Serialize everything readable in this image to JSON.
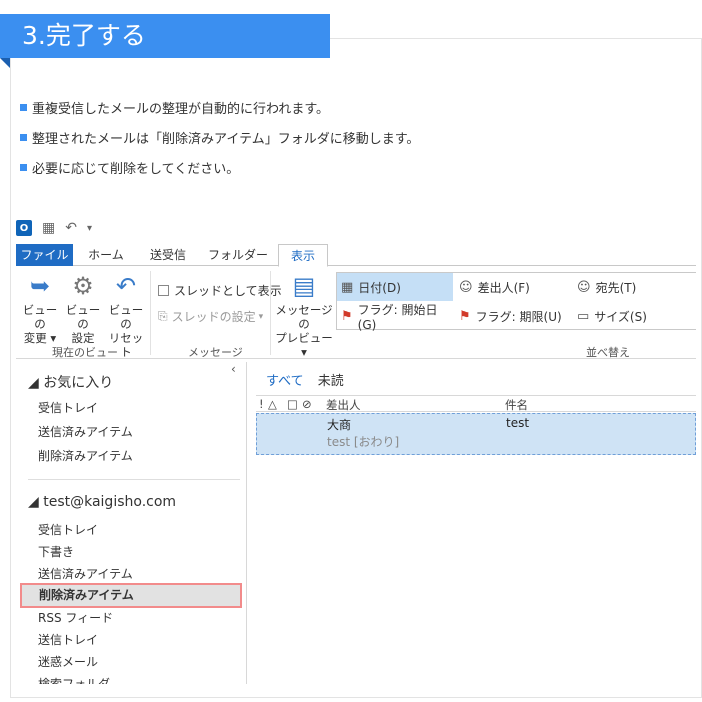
{
  "step": {
    "title": "3.完了する"
  },
  "bullets": [
    "重複受信したメールの整理が自動的に行われます。",
    "整理されたメールは「削除済みアイテム」フォルダに移動します。",
    "必要に応じて削除をしてください。"
  ],
  "qat": {
    "logo": "O",
    "icons": [
      "outlook-logo-icon",
      "send-receive-icon",
      "undo-icon",
      "customize-icon"
    ]
  },
  "tabs": [
    "ファイル",
    "ホーム",
    "送受信",
    "フォルダー",
    "表示"
  ],
  "active_tab": "表示",
  "ribbon": {
    "view_change": [
      "ビューの",
      "変更"
    ],
    "view_settings": [
      "ビューの",
      "設定"
    ],
    "view_reset": [
      "ビューの",
      "リセット"
    ],
    "group_current_view": "現在のビュー",
    "thread_view": "スレッドとして表示",
    "thread_settings": "スレッドの設定",
    "group_messages": "メッセージ",
    "message_preview": [
      "メッセージの",
      "プレビュー"
    ],
    "sort": {
      "date": "日付(D)",
      "from": "差出人(F)",
      "to": "宛先(T)",
      "flag_start": "フラグ: 開始日(G)",
      "flag_due": "フラグ: 期限(U)",
      "size": "サイズ(S)"
    },
    "group_arrange": "並べ替え"
  },
  "folder_pane": {
    "favorites_header": "お気に入り",
    "favorites": [
      "受信トレイ",
      "送信済みアイテム",
      "削除済みアイテム"
    ],
    "account_header": "test@kaigisho.com",
    "account_folders": [
      "受信トレイ",
      "下書き",
      "送信済みアイテム",
      "削除済みアイテム",
      "RSS フィード",
      "送信トレイ",
      "迷惑メール",
      "検索フォルダ"
    ],
    "selected_folder": "削除済みアイテム"
  },
  "mail_list": {
    "filter_all": "すべて",
    "filter_unread": "未読",
    "columns": {
      "importance": "!",
      "reminder": "△",
      "type": "□",
      "attachment": "⊘",
      "from": "差出人",
      "subject": "件名"
    },
    "messages": [
      {
        "from": "大商",
        "subject": "test",
        "preview": "test [おわり]"
      }
    ]
  },
  "colors": {
    "accent": "#3b8ff0",
    "file_tab": "#1f6cc4",
    "selection": "#cfe3f5",
    "highlight_border": "#f28b8b"
  }
}
